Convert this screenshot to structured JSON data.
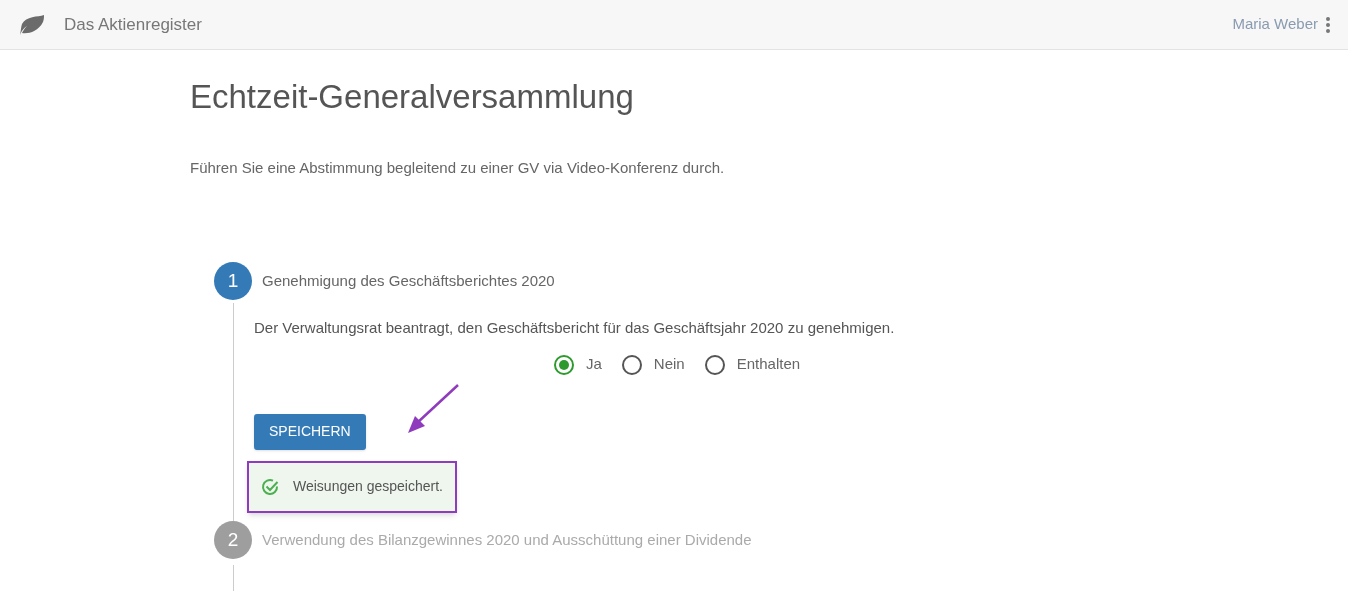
{
  "header": {
    "app_name": "Das Aktienregister",
    "user": "Maria Weber"
  },
  "page": {
    "title": "Echtzeit-Generalversammlung",
    "description": "Führen Sie eine Abstimmung begleitend zu einer GV via Video-Konferenz durch."
  },
  "steps": [
    {
      "number": "1",
      "title": "Genehmigung des Geschäftsberichtes 2020",
      "active": true,
      "motion": "Der Verwaltungsrat beantragt, den Geschäftsbericht für das Geschäftsjahr 2020 zu genehmigen.",
      "options": [
        {
          "label": "Ja",
          "selected": true
        },
        {
          "label": "Nein",
          "selected": false
        },
        {
          "label": "Enthalten",
          "selected": false
        }
      ],
      "button": "SPEICHERN",
      "message": "Weisungen gespeichert."
    },
    {
      "number": "2",
      "title": "Verwendung des Bilanzgewinnes 2020 und Ausschüttung einer Dividende",
      "active": false
    }
  ]
}
